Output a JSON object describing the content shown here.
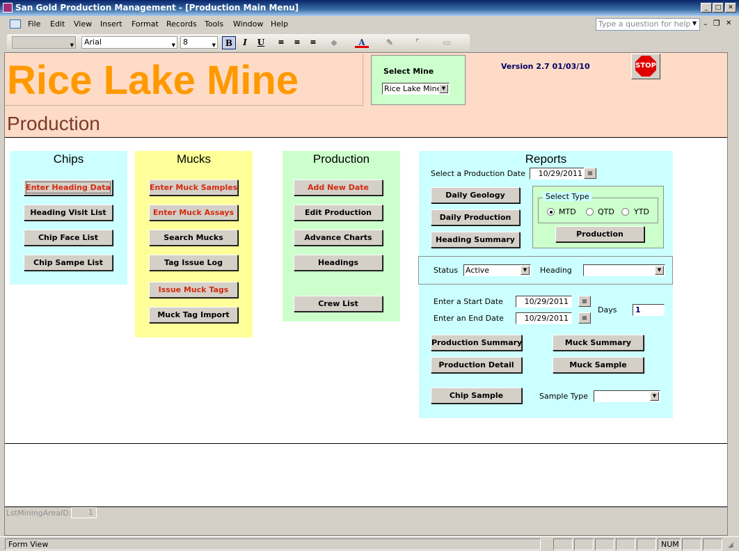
{
  "window": {
    "title": "San Gold Production Management - [Production Main Menu]",
    "min": "_",
    "max": "□",
    "close": "✕"
  },
  "menu": {
    "items": [
      "File",
      "Edit",
      "View",
      "Insert",
      "Format",
      "Records",
      "Tools",
      "Window",
      "Help"
    ],
    "help_placeholder": "Type a question for help",
    "doc_min": "–",
    "doc_restore": "❐",
    "doc_close": "✕"
  },
  "toolbar": {
    "object": "",
    "font": "Arial",
    "size": "8",
    "bold": "B",
    "italic": "I",
    "underline": "U",
    "font_color": "A"
  },
  "header": {
    "app_title": "Rice Lake Mine",
    "section": "Production",
    "select_mine_label": "Select Mine",
    "select_mine_value": "Rice Lake Mine",
    "version": "Version 2.7   01/03/10",
    "stop": "STOP"
  },
  "chips": {
    "title": "Chips",
    "buttons": [
      "Enter Heading Data",
      "Heading Visit List",
      "Chip Face List",
      "Chip Sampe List"
    ]
  },
  "mucks": {
    "title": "Mucks",
    "buttons": [
      "Enter Muck Samples",
      "Enter Muck Assays",
      "Search Mucks",
      "Tag Issue Log",
      "Issue Muck Tags",
      "Muck Tag Import"
    ]
  },
  "production": {
    "title": "Production",
    "buttons": [
      "Add New Date",
      "Edit Production",
      "Advance Charts",
      "Headings",
      "Crew List"
    ]
  },
  "reports": {
    "title": "Reports",
    "prod_date_label": "Select a Production Date",
    "prod_date": "10/29/2011",
    "buttons": {
      "daily_geology": "Daily Geology",
      "daily_production": "Daily Production",
      "heading_summary": "Heading Summary",
      "production": "Production",
      "production_summary": "Production Summary",
      "muck_summary": "Muck Summary",
      "production_detail": "Production Detail",
      "muck_sample": "Muck Sample",
      "chip_sample": "Chip Sample"
    },
    "select_type": {
      "label": "Select Type",
      "options": [
        "MTD",
        "QTD",
        "YTD"
      ],
      "selected": "MTD"
    },
    "status_label": "Status",
    "status_value": "Active",
    "heading_label": "Heading",
    "heading_value": "",
    "start_label": "Enter a Start Date",
    "start_date": "10/29/2011",
    "end_label": "Enter an End Date",
    "end_date": "10/29/2011",
    "days_label": "Days",
    "days_value": "1",
    "sample_type_label": "Sample Type",
    "sample_type_value": ""
  },
  "footer": {
    "field_label": "LstMiningAreaID:",
    "field_value": "1"
  },
  "status": {
    "mode": "Form View",
    "num": "NUM"
  }
}
